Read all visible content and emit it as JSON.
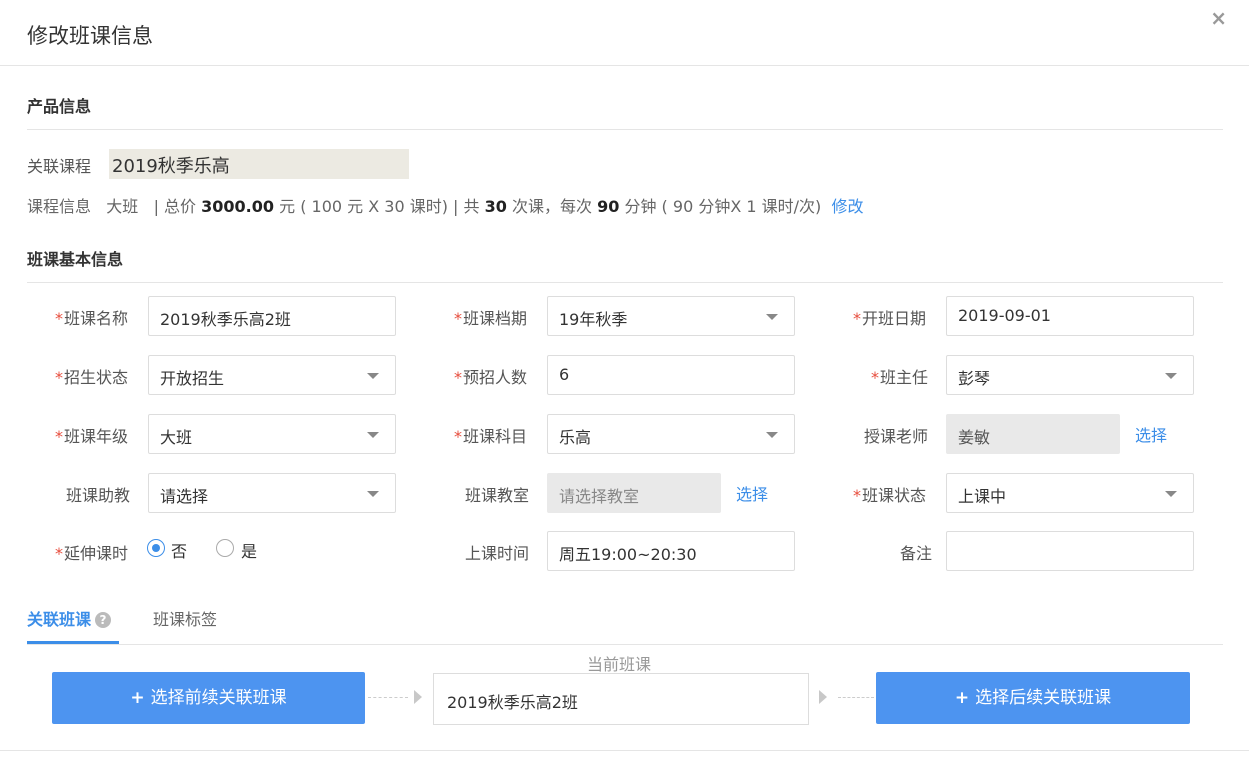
{
  "dialog": {
    "title": "修改班课信息",
    "close_label": "×"
  },
  "product": {
    "section_title": "产品信息",
    "course_label": "关联课程",
    "course_value": "2019秋季乐高",
    "info_label": "课程信息",
    "class_type": "大班",
    "price_prefix": "| 总价",
    "total_price": "3000.00",
    "price_detail": "元 ( 100 元 X 30 课时) | 共",
    "lesson_count": "30",
    "lesson_text": "次课，每次",
    "minutes": "90",
    "minutes_detail": "分钟 ( 90 分钟X 1 课时/次)",
    "edit_link": "修改"
  },
  "basic": {
    "section_title": "班课基本信息",
    "required_mark": "*",
    "class_name_label": "班课名称",
    "class_name_value": "2019秋季乐高2班",
    "term_label": "班课档期",
    "term_value": "19年秋季",
    "start_date_label": "开班日期",
    "start_date_value": "2019-09-01",
    "enroll_status_label": "招生状态",
    "enroll_status_value": "开放招生",
    "planned_count_label": "预招人数",
    "planned_count_value": "6",
    "head_teacher_label": "班主任",
    "head_teacher_value": "彭琴",
    "grade_label": "班课年级",
    "grade_value": "大班",
    "subject_label": "班课科目",
    "subject_value": "乐高",
    "teacher_label": "授课老师",
    "teacher_value": "姜敏",
    "teacher_select": "选择",
    "assistant_label": "班课助教",
    "assistant_value": "请选择",
    "classroom_label": "班课教室",
    "classroom_placeholder": "请选择教室",
    "classroom_select": "选择",
    "class_status_label": "班课状态",
    "class_status_value": "上课中",
    "extend_label": "延伸课时",
    "extend_no": "否",
    "extend_yes": "是",
    "extend_selected": "否",
    "schedule_label": "上课时间",
    "schedule_value": "周五19:00~20:30",
    "remark_label": "备注",
    "remark_value": ""
  },
  "tabs": {
    "linked": "关联班课",
    "tags": "班课标签",
    "help_icon": "?"
  },
  "linkage": {
    "prev_button": "选择前续关联班课",
    "next_button": "选择后续关联班课",
    "current_label": "当前班课",
    "current_value": "2019秋季乐高2班",
    "plus": "+"
  },
  "colors": {
    "accent": "#3c8ee8",
    "button": "#4d94f0",
    "required": "#e74c3c"
  }
}
